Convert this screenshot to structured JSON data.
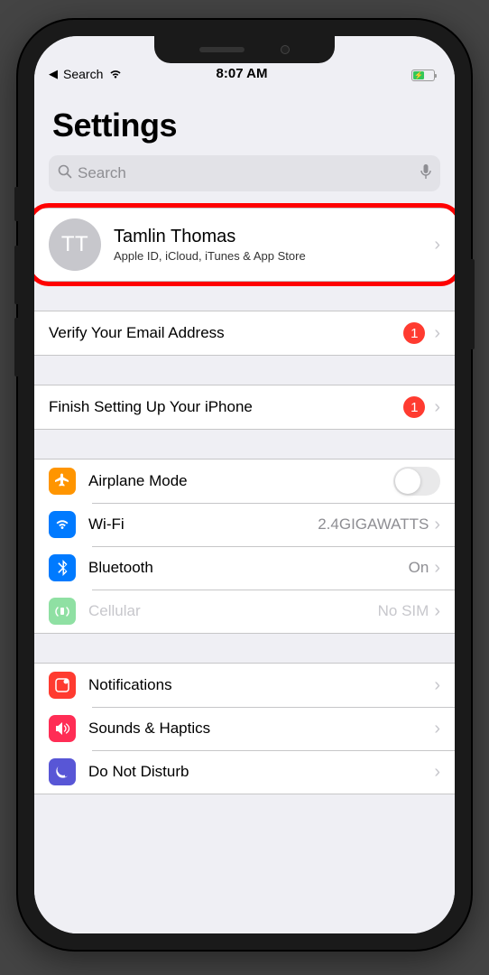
{
  "status_bar": {
    "back_label": "Search",
    "time": "8:07 AM"
  },
  "page_title": "Settings",
  "search": {
    "placeholder": "Search"
  },
  "profile": {
    "initials": "TT",
    "name": "Tamlin Thomas",
    "subtitle": "Apple ID, iCloud, iTunes & App Store"
  },
  "alerts": [
    {
      "label": "Verify Your Email Address",
      "badge": "1"
    },
    {
      "label": "Finish Setting Up Your iPhone",
      "badge": "1"
    }
  ],
  "network": {
    "airplane": {
      "label": "Airplane Mode"
    },
    "wifi": {
      "label": "Wi-Fi",
      "value": "2.4GIGAWATTS"
    },
    "bluetooth": {
      "label": "Bluetooth",
      "value": "On"
    },
    "cellular": {
      "label": "Cellular",
      "value": "No SIM"
    }
  },
  "general": {
    "notifications": {
      "label": "Notifications"
    },
    "sounds": {
      "label": "Sounds & Haptics"
    },
    "dnd": {
      "label": "Do Not Disturb"
    }
  },
  "colors": {
    "orange": "#ff9500",
    "blue": "#007aff",
    "green": "#34c759",
    "red": "#ff3b30",
    "pink": "#ff2d55",
    "purple": "#5856d6"
  }
}
